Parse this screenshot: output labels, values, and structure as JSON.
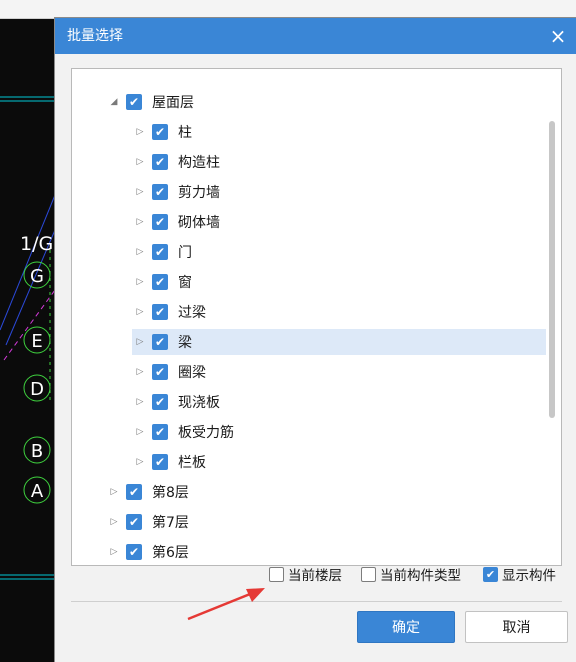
{
  "cad": {
    "labels": [
      "1/G",
      "G",
      "E",
      "D",
      "B",
      "A"
    ]
  },
  "dialog": {
    "title": "批量选择",
    "close_glyph": "×",
    "tree": {
      "root": "屋面层",
      "children": [
        "柱",
        "构造柱",
        "剪力墙",
        "砌体墙",
        "门",
        "窗",
        "过梁",
        "梁",
        "圈梁",
        "现浇板",
        "板受力筋",
        "栏板"
      ],
      "selected_child": "梁",
      "siblings": [
        "第8层",
        "第7层",
        "第6层"
      ]
    },
    "options": [
      {
        "label": "当前楼层",
        "checked": false
      },
      {
        "label": "当前构件类型",
        "checked": false
      },
      {
        "label": "显示构件",
        "checked": true
      }
    ],
    "buttons": {
      "ok": "确定",
      "cancel": "取消"
    }
  },
  "colors": {
    "accent": "#3a86d6",
    "selection": "#dde9f8",
    "annotation_arrow": "#e53935"
  }
}
